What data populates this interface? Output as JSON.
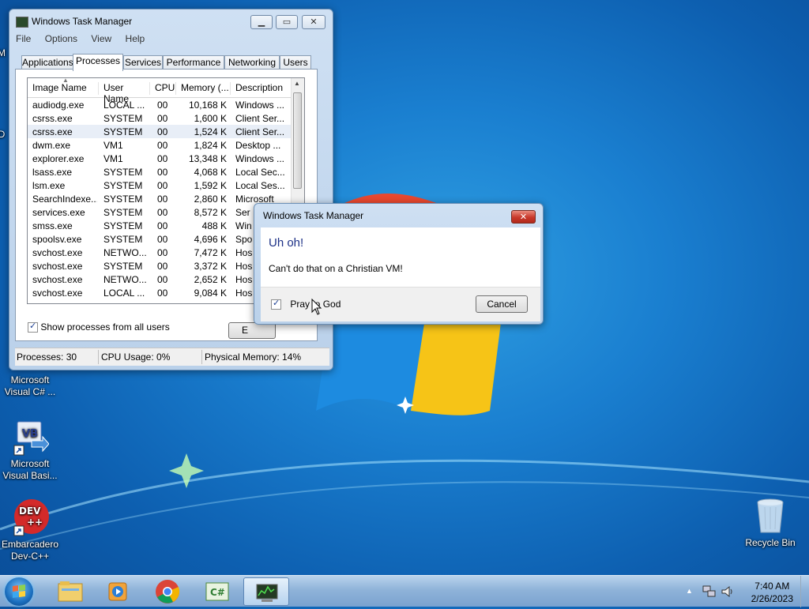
{
  "desktop": {
    "icons": [
      {
        "line1": "Microsoft",
        "line2": "Visual C# ..."
      },
      {
        "line1": "Microsoft",
        "line2": "Visual Basi..."
      },
      {
        "line1": "Embarcadero",
        "line2": "Dev-C++"
      },
      {
        "line1": "Recycle Bin",
        "line2": ""
      }
    ],
    "vb_icon_text": "VB",
    "dev_icon_text": "DEV",
    "dev_icon_sub": "++",
    "partial_labels": {
      "m": "M",
      "d": "D"
    }
  },
  "task_manager": {
    "title": "Windows Task Manager",
    "menu": [
      "File",
      "Options",
      "View",
      "Help"
    ],
    "tabs": [
      "Applications",
      "Processes",
      "Services",
      "Performance",
      "Networking",
      "Users"
    ],
    "selected_tab": "Processes",
    "columns": [
      "Image Name",
      "User Name",
      "CPU",
      "Memory (...",
      "Description"
    ],
    "rows": [
      {
        "image": "audiodg.exe",
        "user": "LOCAL ...",
        "cpu": "00",
        "mem": "10,168 K",
        "desc": "Windows ..."
      },
      {
        "image": "csrss.exe",
        "user": "SYSTEM",
        "cpu": "00",
        "mem": "1,600 K",
        "desc": "Client Ser..."
      },
      {
        "image": "csrss.exe",
        "user": "SYSTEM",
        "cpu": "00",
        "mem": "1,524 K",
        "desc": "Client Ser..."
      },
      {
        "image": "dwm.exe",
        "user": "VM1",
        "cpu": "00",
        "mem": "1,824 K",
        "desc": "Desktop ..."
      },
      {
        "image": "explorer.exe",
        "user": "VM1",
        "cpu": "00",
        "mem": "13,348 K",
        "desc": "Windows ..."
      },
      {
        "image": "lsass.exe",
        "user": "SYSTEM",
        "cpu": "00",
        "mem": "4,068 K",
        "desc": "Local Sec..."
      },
      {
        "image": "lsm.exe",
        "user": "SYSTEM",
        "cpu": "00",
        "mem": "1,592 K",
        "desc": "Local Ses..."
      },
      {
        "image": "SearchIndexe...",
        "user": "SYSTEM",
        "cpu": "00",
        "mem": "2,860 K",
        "desc": "Microsoft"
      },
      {
        "image": "services.exe",
        "user": "SYSTEM",
        "cpu": "00",
        "mem": "8,572 K",
        "desc": "Ser"
      },
      {
        "image": "smss.exe",
        "user": "SYSTEM",
        "cpu": "00",
        "mem": "488 K",
        "desc": "Win"
      },
      {
        "image": "spoolsv.exe",
        "user": "SYSTEM",
        "cpu": "00",
        "mem": "4,696 K",
        "desc": "Spo"
      },
      {
        "image": "svchost.exe",
        "user": "NETWO...",
        "cpu": "00",
        "mem": "7,472 K",
        "desc": "Hos"
      },
      {
        "image": "svchost.exe",
        "user": "SYSTEM",
        "cpu": "00",
        "mem": "3,372 K",
        "desc": "Hos"
      },
      {
        "image": "svchost.exe",
        "user": "NETWO...",
        "cpu": "00",
        "mem": "2,652 K",
        "desc": "Hos"
      },
      {
        "image": "svchost.exe",
        "user": "LOCAL ...",
        "cpu": "00",
        "mem": "9,084 K",
        "desc": "Hos"
      }
    ],
    "show_all_label": "Show processes from all users",
    "end_process_partial": "E",
    "status": {
      "processes": "Processes: 30",
      "cpu": "CPU Usage: 0%",
      "memory": "Physical Memory: 14%"
    }
  },
  "dialog": {
    "title": "Windows Task Manager",
    "heading": "Uh oh!",
    "message": "Can't do that on a Christian VM!",
    "checkbox_label": "Pray to God",
    "cancel_label": "Cancel",
    "close_glyph": "✕"
  },
  "taskbar": {
    "time": "7:40 AM",
    "date": "2/26/2023",
    "csharp_text": "C#"
  },
  "colors": {
    "dialog_heading": "#1e3287",
    "close_button": "#c8382a"
  }
}
